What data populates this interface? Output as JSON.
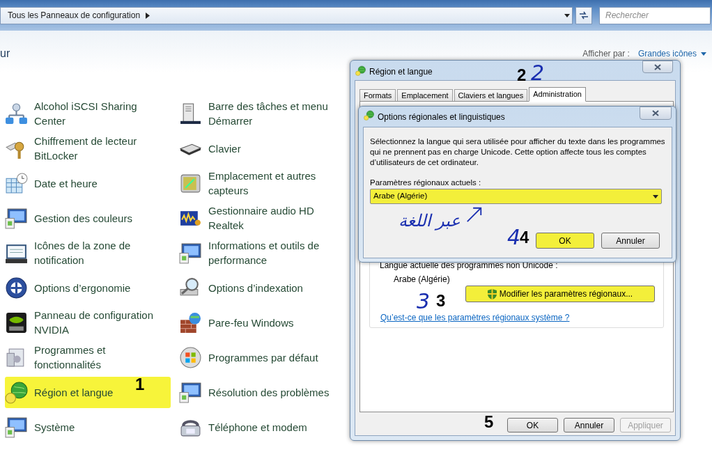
{
  "address_bar": {
    "path": "Tous les Panneaux de configuration",
    "search_placeholder": "Rechercher"
  },
  "header": {
    "title_fragment": "ur",
    "view_label": "Afficher par :",
    "view_value": "Grandes icônes"
  },
  "items": [
    {
      "label": "Alcohol iSCSI Sharing Center",
      "highlighted": false
    },
    {
      "label": "Chiffrement de lecteur BitLocker",
      "highlighted": false
    },
    {
      "label": "Date et heure",
      "highlighted": false
    },
    {
      "label": "Gestion des couleurs",
      "highlighted": false
    },
    {
      "label": "Icônes de la zone de notification",
      "highlighted": false
    },
    {
      "label": "Options d’ergonomie",
      "highlighted": false
    },
    {
      "label": "Panneau de configuration NVIDIA",
      "highlighted": false
    },
    {
      "label": "Programmes et fonctionnalités",
      "highlighted": false
    },
    {
      "label": "Région et langue",
      "highlighted": true
    },
    {
      "label": "Système",
      "highlighted": false
    },
    {
      "label": "Barre des tâches et menu Démarrer",
      "highlighted": false
    },
    {
      "label": "Clavier",
      "highlighted": false
    },
    {
      "label": "Emplacement et autres capteurs",
      "highlighted": false
    },
    {
      "label": "Gestionnaire audio HD Realtek",
      "highlighted": false
    },
    {
      "label": "Informations et outils de performance",
      "highlighted": false
    },
    {
      "label": "Options d’indexation",
      "highlighted": false
    },
    {
      "label": "Pare-feu Windows",
      "highlighted": false
    },
    {
      "label": "Programmes par défaut",
      "highlighted": false
    },
    {
      "label": "Résolution des problèmes",
      "highlighted": false
    },
    {
      "label": "Téléphone et modem",
      "highlighted": false
    }
  ],
  "region_dialog": {
    "title": "Région et langue",
    "tabs": [
      {
        "label": "Formats",
        "selected": false
      },
      {
        "label": "Emplacement",
        "selected": false
      },
      {
        "label": "Claviers et langues",
        "selected": false
      },
      {
        "label": "Administration",
        "selected": true
      }
    ],
    "current_language_label": "Langue actuelle des programmes non Unicode :",
    "current_language": "Arabe (Algérie)",
    "change_button": {
      "label": "Modifier les paramètres régionaux...",
      "highlighted": true
    },
    "help_link": "Qu’est-ce que les paramètres régionaux système ?",
    "buttons": [
      {
        "label": "OK",
        "disabled": false
      },
      {
        "label": "Annuler",
        "disabled": false
      },
      {
        "label": "Appliquer",
        "disabled": true
      }
    ]
  },
  "options_dialog": {
    "title": "Options régionales et linguistiques",
    "description": "Sélectionnez la langue qui sera utilisée pour afficher du texte dans les programmes qui ne prennent pas en charge Unicode. Cette option affecte tous les comptes d’utilisateurs de cet ordinateur.",
    "locale_label": "Paramètres régionaux actuels :",
    "locale": {
      "value": "Arabe (Algérie)",
      "highlighted": true
    },
    "buttons": [
      {
        "label": "OK",
        "highlighted": true
      },
      {
        "label": "Annuler",
        "highlighted": false
      }
    ]
  },
  "annotations": [
    {
      "kind": "printed",
      "text": "1"
    },
    {
      "kind": "printed",
      "text": "2"
    },
    {
      "kind": "handwritten",
      "text": "2"
    },
    {
      "kind": "handwritten",
      "text": "3"
    },
    {
      "kind": "printed",
      "text": "3"
    },
    {
      "kind": "handwritten",
      "text": "عبر اللغة"
    },
    {
      "kind": "handwritten",
      "text": "4"
    },
    {
      "kind": "printed",
      "text": "4"
    },
    {
      "kind": "printed",
      "text": "5"
    }
  ]
}
